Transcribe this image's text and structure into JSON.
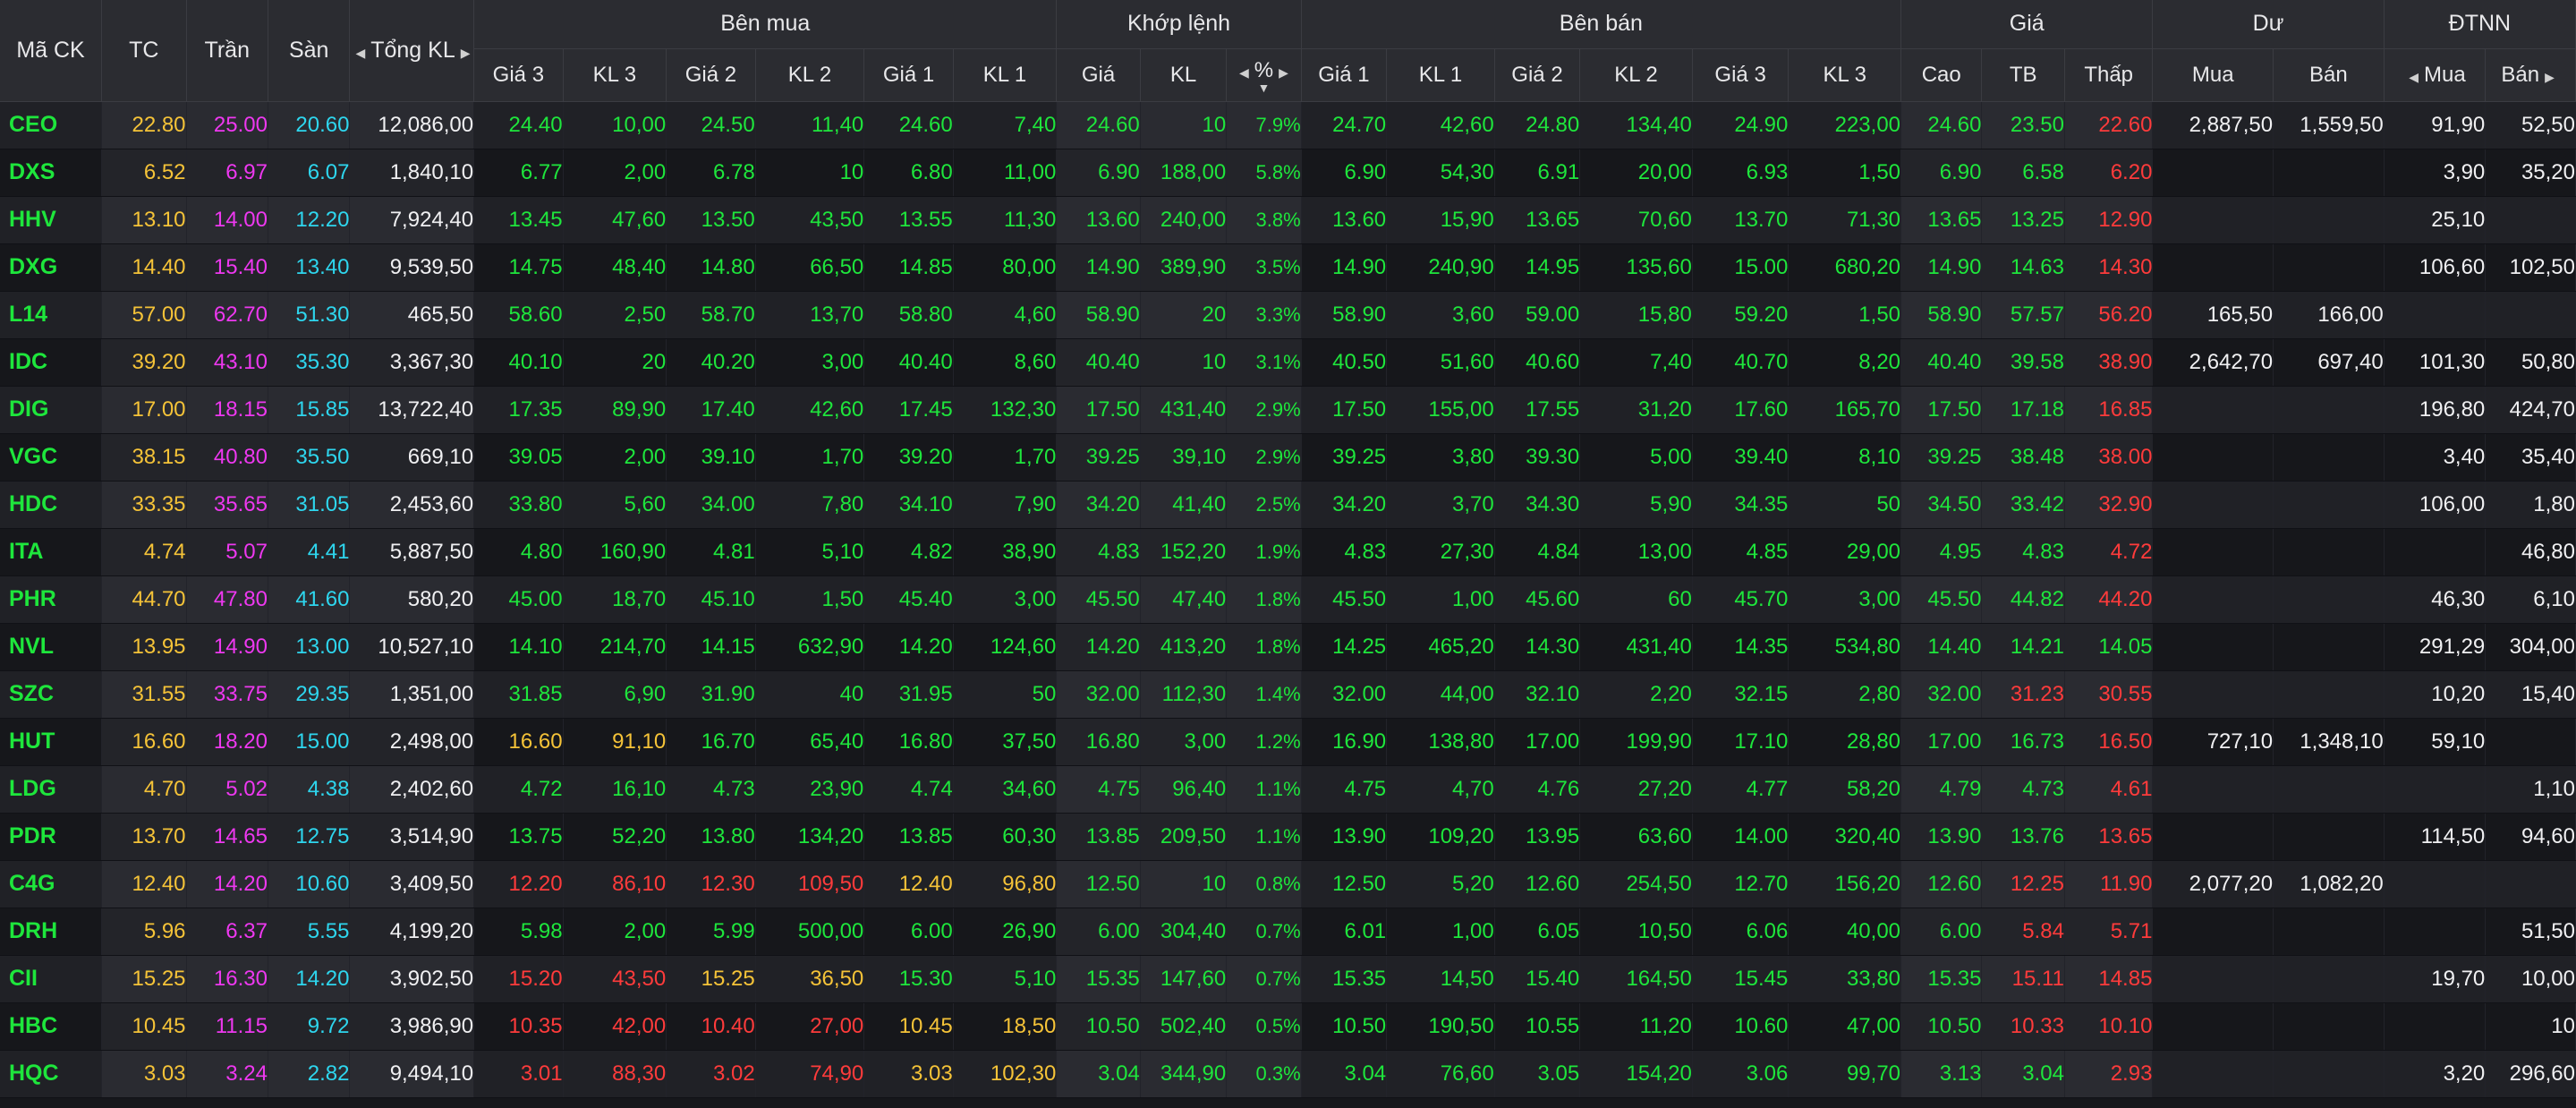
{
  "colors": {
    "up": "#1ee63c",
    "down": "#ff3b3b",
    "reference": "#f5c338",
    "ceiling": "#ee38f0",
    "floor": "#2ed6ee",
    "neutral": "#f0f0f2",
    "header_bg": "#2b2c31",
    "row_odd": "#202126",
    "row_even": "#16171b"
  },
  "icons": {
    "left": "chevron-left-icon",
    "right": "chevron-right-icon",
    "sort": "sort-desc-icon"
  },
  "header": {
    "symbol": "Mã CK",
    "ref": "TC",
    "ceiling": "Trần",
    "floor": "Sàn",
    "total_volume": "Tổng KL",
    "bid_group": "Bên mua",
    "match_group": "Khớp lệnh",
    "ask_group": "Bên bán",
    "price_group": "Giá",
    "remain_group": "Dư",
    "foreign_group": "ĐTNN",
    "bid_cols": [
      "Giá 3",
      "KL 3",
      "Giá 2",
      "KL 2",
      "Giá 1",
      "KL 1"
    ],
    "match_cols": [
      "Giá",
      "KL",
      "%"
    ],
    "ask_cols": [
      "Giá 1",
      "KL 1",
      "Giá 2",
      "KL 2",
      "Giá 3",
      "KL 3"
    ],
    "price_cols": [
      "Cao",
      "TB",
      "Thấp"
    ],
    "remain_cols": [
      "Mua",
      "Bán"
    ],
    "foreign_cols": [
      "Mua",
      "Bán"
    ]
  },
  "rows": [
    {
      "sym": "CEO",
      "tc": "22.80",
      "tran": "25.00",
      "san": "20.60",
      "tong": "12,086,00",
      "b3": "24.40",
      "bk3": "10,00",
      "b2": "24.50",
      "bk2": "11,40",
      "b1": "24.60",
      "bk1": "7,40",
      "mp": "24.60",
      "mk": "10",
      "pct": "7.9%",
      "a1": "24.70",
      "ak1": "42,60",
      "a2": "24.80",
      "ak2": "134,40",
      "a3": "24.90",
      "ak3": "223,00",
      "cao": "24.60",
      "tb": "23.50",
      "thap": "22.60",
      "dm": "2,887,50",
      "db": "1,559,50",
      "fm": "91,90",
      "fb": "52,50",
      "c": {
        "b3": "up",
        "b2": "up",
        "b1": "up",
        "mp": "up",
        "a1": "up",
        "a2": "up",
        "a3": "up",
        "cao": "up",
        "tb": "up",
        "thap": "down"
      }
    },
    {
      "sym": "DXS",
      "tc": "6.52",
      "tran": "6.97",
      "san": "6.07",
      "tong": "1,840,10",
      "b3": "6.77",
      "bk3": "2,00",
      "b2": "6.78",
      "bk2": "10",
      "b1": "6.80",
      "bk1": "11,00",
      "mp": "6.90",
      "mk": "188,00",
      "pct": "5.8%",
      "a1": "6.90",
      "ak1": "54,30",
      "a2": "6.91",
      "ak2": "20,00",
      "a3": "6.93",
      "ak3": "1,50",
      "cao": "6.90",
      "tb": "6.58",
      "thap": "6.20",
      "dm": "",
      "db": "",
      "fm": "3,90",
      "fb": "35,20",
      "c": {
        "b3": "up",
        "b2": "up",
        "b1": "up",
        "mp": "up",
        "a1": "up",
        "a2": "up",
        "a3": "up",
        "cao": "up",
        "tb": "up",
        "thap": "down"
      }
    },
    {
      "sym": "HHV",
      "tc": "13.10",
      "tran": "14.00",
      "san": "12.20",
      "tong": "7,924,40",
      "b3": "13.45",
      "bk3": "47,60",
      "b2": "13.50",
      "bk2": "43,50",
      "b1": "13.55",
      "bk1": "11,30",
      "mp": "13.60",
      "mk": "240,00",
      "pct": "3.8%",
      "a1": "13.60",
      "ak1": "15,90",
      "a2": "13.65",
      "ak2": "70,60",
      "a3": "13.70",
      "ak3": "71,30",
      "cao": "13.65",
      "tb": "13.25",
      "thap": "12.90",
      "dm": "",
      "db": "",
      "fm": "25,10",
      "fb": "",
      "c": {
        "b3": "up",
        "b2": "up",
        "b1": "up",
        "mp": "up",
        "a1": "up",
        "a2": "up",
        "a3": "up",
        "cao": "up",
        "tb": "up",
        "thap": "down"
      }
    },
    {
      "sym": "DXG",
      "tc": "14.40",
      "tran": "15.40",
      "san": "13.40",
      "tong": "9,539,50",
      "b3": "14.75",
      "bk3": "48,40",
      "b2": "14.80",
      "bk2": "66,50",
      "b1": "14.85",
      "bk1": "80,00",
      "mp": "14.90",
      "mk": "389,90",
      "pct": "3.5%",
      "a1": "14.90",
      "ak1": "240,90",
      "a2": "14.95",
      "ak2": "135,60",
      "a3": "15.00",
      "ak3": "680,20",
      "cao": "14.90",
      "tb": "14.63",
      "thap": "14.30",
      "dm": "",
      "db": "",
      "fm": "106,60",
      "fb": "102,50",
      "c": {
        "b3": "up",
        "b2": "up",
        "b1": "up",
        "mp": "up",
        "a1": "up",
        "a2": "up",
        "a3": "up",
        "cao": "up",
        "tb": "up",
        "thap": "down"
      }
    },
    {
      "sym": "L14",
      "tc": "57.00",
      "tran": "62.70",
      "san": "51.30",
      "tong": "465,50",
      "b3": "58.60",
      "bk3": "2,50",
      "b2": "58.70",
      "bk2": "13,70",
      "b1": "58.80",
      "bk1": "4,60",
      "mp": "58.90",
      "mk": "20",
      "pct": "3.3%",
      "a1": "58.90",
      "ak1": "3,60",
      "a2": "59.00",
      "ak2": "15,80",
      "a3": "59.20",
      "ak3": "1,50",
      "cao": "58.90",
      "tb": "57.57",
      "thap": "56.20",
      "dm": "165,50",
      "db": "166,00",
      "fm": "",
      "fb": "",
      "c": {
        "b3": "up",
        "b2": "up",
        "b1": "up",
        "mp": "up",
        "a1": "up",
        "a2": "up",
        "a3": "up",
        "cao": "up",
        "tb": "up",
        "thap": "down"
      }
    },
    {
      "sym": "IDC",
      "tc": "39.20",
      "tran": "43.10",
      "san": "35.30",
      "tong": "3,367,30",
      "b3": "40.10",
      "bk3": "20",
      "b2": "40.20",
      "bk2": "3,00",
      "b1": "40.40",
      "bk1": "8,60",
      "mp": "40.40",
      "mk": "10",
      "pct": "3.1%",
      "a1": "40.50",
      "ak1": "51,60",
      "a2": "40.60",
      "ak2": "7,40",
      "a3": "40.70",
      "ak3": "8,20",
      "cao": "40.40",
      "tb": "39.58",
      "thap": "38.90",
      "dm": "2,642,70",
      "db": "697,40",
      "fm": "101,30",
      "fb": "50,80",
      "c": {
        "b3": "up",
        "b2": "up",
        "b1": "up",
        "mp": "up",
        "a1": "up",
        "a2": "up",
        "a3": "up",
        "cao": "up",
        "tb": "up",
        "thap": "down"
      }
    },
    {
      "sym": "DIG",
      "tc": "17.00",
      "tran": "18.15",
      "san": "15.85",
      "tong": "13,722,40",
      "b3": "17.35",
      "bk3": "89,90",
      "b2": "17.40",
      "bk2": "42,60",
      "b1": "17.45",
      "bk1": "132,30",
      "mp": "17.50",
      "mk": "431,40",
      "pct": "2.9%",
      "a1": "17.50",
      "ak1": "155,00",
      "a2": "17.55",
      "ak2": "31,20",
      "a3": "17.60",
      "ak3": "165,70",
      "cao": "17.50",
      "tb": "17.18",
      "thap": "16.85",
      "dm": "",
      "db": "",
      "fm": "196,80",
      "fb": "424,70",
      "c": {
        "b3": "up",
        "b2": "up",
        "b1": "up",
        "mp": "up",
        "a1": "up",
        "a2": "up",
        "a3": "up",
        "cao": "up",
        "tb": "up",
        "thap": "down"
      }
    },
    {
      "sym": "VGC",
      "tc": "38.15",
      "tran": "40.80",
      "san": "35.50",
      "tong": "669,10",
      "b3": "39.05",
      "bk3": "2,00",
      "b2": "39.10",
      "bk2": "1,70",
      "b1": "39.20",
      "bk1": "1,70",
      "mp": "39.25",
      "mk": "39,10",
      "pct": "2.9%",
      "a1": "39.25",
      "ak1": "3,80",
      "a2": "39.30",
      "ak2": "5,00",
      "a3": "39.40",
      "ak3": "8,10",
      "cao": "39.25",
      "tb": "38.48",
      "thap": "38.00",
      "dm": "",
      "db": "",
      "fm": "3,40",
      "fb": "35,40",
      "c": {
        "b3": "up",
        "b2": "up",
        "b1": "up",
        "mp": "up",
        "a1": "up",
        "a2": "up",
        "a3": "up",
        "cao": "up",
        "tb": "up",
        "thap": "down"
      }
    },
    {
      "sym": "HDC",
      "tc": "33.35",
      "tran": "35.65",
      "san": "31.05",
      "tong": "2,453,60",
      "b3": "33.80",
      "bk3": "5,60",
      "b2": "34.00",
      "bk2": "7,80",
      "b1": "34.10",
      "bk1": "7,90",
      "mp": "34.20",
      "mk": "41,40",
      "pct": "2.5%",
      "a1": "34.20",
      "ak1": "3,70",
      "a2": "34.30",
      "ak2": "5,90",
      "a3": "34.35",
      "ak3": "50",
      "cao": "34.50",
      "tb": "33.42",
      "thap": "32.90",
      "dm": "",
      "db": "",
      "fm": "106,00",
      "fb": "1,80",
      "c": {
        "b3": "up",
        "b2": "up",
        "b1": "up",
        "mp": "up",
        "a1": "up",
        "a2": "up",
        "a3": "up",
        "cao": "up",
        "tb": "up",
        "thap": "down"
      }
    },
    {
      "sym": "ITA",
      "tc": "4.74",
      "tran": "5.07",
      "san": "4.41",
      "tong": "5,887,50",
      "b3": "4.80",
      "bk3": "160,90",
      "b2": "4.81",
      "bk2": "5,10",
      "b1": "4.82",
      "bk1": "38,90",
      "mp": "4.83",
      "mk": "152,20",
      "pct": "1.9%",
      "a1": "4.83",
      "ak1": "27,30",
      "a2": "4.84",
      "ak2": "13,00",
      "a3": "4.85",
      "ak3": "29,00",
      "cao": "4.95",
      "tb": "4.83",
      "thap": "4.72",
      "dm": "",
      "db": "",
      "fm": "",
      "fb": "46,80",
      "c": {
        "b3": "up",
        "b2": "up",
        "b1": "up",
        "mp": "up",
        "a1": "up",
        "a2": "up",
        "a3": "up",
        "cao": "up",
        "tb": "up",
        "thap": "down"
      }
    },
    {
      "sym": "PHR",
      "tc": "44.70",
      "tran": "47.80",
      "san": "41.60",
      "tong": "580,20",
      "b3": "45.00",
      "bk3": "18,70",
      "b2": "45.10",
      "bk2": "1,50",
      "b1": "45.40",
      "bk1": "3,00",
      "mp": "45.50",
      "mk": "47,40",
      "pct": "1.8%",
      "a1": "45.50",
      "ak1": "1,00",
      "a2": "45.60",
      "ak2": "60",
      "a3": "45.70",
      "ak3": "3,00",
      "cao": "45.50",
      "tb": "44.82",
      "thap": "44.20",
      "dm": "",
      "db": "",
      "fm": "46,30",
      "fb": "6,10",
      "c": {
        "b3": "up",
        "b2": "up",
        "b1": "up",
        "mp": "up",
        "a1": "up",
        "a2": "up",
        "a3": "up",
        "cao": "up",
        "tb": "up",
        "thap": "down"
      }
    },
    {
      "sym": "NVL",
      "tc": "13.95",
      "tran": "14.90",
      "san": "13.00",
      "tong": "10,527,10",
      "b3": "14.10",
      "bk3": "214,70",
      "b2": "14.15",
      "bk2": "632,90",
      "b1": "14.20",
      "bk1": "124,60",
      "mp": "14.20",
      "mk": "413,20",
      "pct": "1.8%",
      "a1": "14.25",
      "ak1": "465,20",
      "a2": "14.30",
      "ak2": "431,40",
      "a3": "14.35",
      "ak3": "534,80",
      "cao": "14.40",
      "tb": "14.21",
      "thap": "14.05",
      "dm": "",
      "db": "",
      "fm": "291,29",
      "fb": "304,00",
      "c": {
        "b3": "up",
        "b2": "up",
        "b1": "up",
        "mp": "up",
        "a1": "up",
        "a2": "up",
        "a3": "up",
        "cao": "up",
        "tb": "up",
        "thap": "up"
      }
    },
    {
      "sym": "SZC",
      "tc": "31.55",
      "tran": "33.75",
      "san": "29.35",
      "tong": "1,351,00",
      "b3": "31.85",
      "bk3": "6,90",
      "b2": "31.90",
      "bk2": "40",
      "b1": "31.95",
      "bk1": "50",
      "mp": "32.00",
      "mk": "112,30",
      "pct": "1.4%",
      "a1": "32.00",
      "ak1": "44,00",
      "a2": "32.10",
      "ak2": "2,20",
      "a3": "32.15",
      "ak3": "2,80",
      "cao": "32.00",
      "tb": "31.23",
      "thap": "30.55",
      "dm": "",
      "db": "",
      "fm": "10,20",
      "fb": "15,40",
      "c": {
        "b3": "up",
        "b2": "up",
        "b1": "up",
        "mp": "up",
        "a1": "up",
        "a2": "up",
        "a3": "up",
        "cao": "up",
        "tb": "down",
        "thap": "down"
      }
    },
    {
      "sym": "HUT",
      "tc": "16.60",
      "tran": "18.20",
      "san": "15.00",
      "tong": "2,498,00",
      "b3": "16.60",
      "bk3": "91,10",
      "b2": "16.70",
      "bk2": "65,40",
      "b1": "16.80",
      "bk1": "37,50",
      "mp": "16.80",
      "mk": "3,00",
      "pct": "1.2%",
      "a1": "16.90",
      "ak1": "138,80",
      "a2": "17.00",
      "ak2": "199,90",
      "a3": "17.10",
      "ak3": "28,80",
      "cao": "17.00",
      "tb": "16.73",
      "thap": "16.50",
      "dm": "727,10",
      "db": "1,348,10",
      "fm": "59,10",
      "fb": "",
      "c": {
        "b3": "ref",
        "b2": "up",
        "b1": "up",
        "mp": "up",
        "a1": "up",
        "a2": "up",
        "a3": "up",
        "cao": "up",
        "tb": "up",
        "thap": "down"
      }
    },
    {
      "sym": "LDG",
      "tc": "4.70",
      "tran": "5.02",
      "san": "4.38",
      "tong": "2,402,60",
      "b3": "4.72",
      "bk3": "16,10",
      "b2": "4.73",
      "bk2": "23,90",
      "b1": "4.74",
      "bk1": "34,60",
      "mp": "4.75",
      "mk": "96,40",
      "pct": "1.1%",
      "a1": "4.75",
      "ak1": "4,70",
      "a2": "4.76",
      "ak2": "27,20",
      "a3": "4.77",
      "ak3": "58,20",
      "cao": "4.79",
      "tb": "4.73",
      "thap": "4.61",
      "dm": "",
      "db": "",
      "fm": "",
      "fb": "1,10",
      "c": {
        "b3": "up",
        "b2": "up",
        "b1": "up",
        "mp": "up",
        "a1": "up",
        "a2": "up",
        "a3": "up",
        "cao": "up",
        "tb": "up",
        "thap": "down"
      }
    },
    {
      "sym": "PDR",
      "tc": "13.70",
      "tran": "14.65",
      "san": "12.75",
      "tong": "3,514,90",
      "b3": "13.75",
      "bk3": "52,20",
      "b2": "13.80",
      "bk2": "134,20",
      "b1": "13.85",
      "bk1": "60,30",
      "mp": "13.85",
      "mk": "209,50",
      "pct": "1.1%",
      "a1": "13.90",
      "ak1": "109,20",
      "a2": "13.95",
      "ak2": "63,60",
      "a3": "14.00",
      "ak3": "320,40",
      "cao": "13.90",
      "tb": "13.76",
      "thap": "13.65",
      "dm": "",
      "db": "",
      "fm": "114,50",
      "fb": "94,60",
      "c": {
        "b3": "up",
        "b2": "up",
        "b1": "up",
        "mp": "up",
        "a1": "up",
        "a2": "up",
        "a3": "up",
        "cao": "up",
        "tb": "up",
        "thap": "down"
      }
    },
    {
      "sym": "C4G",
      "tc": "12.40",
      "tran": "14.20",
      "san": "10.60",
      "tong": "3,409,50",
      "b3": "12.20",
      "bk3": "86,10",
      "b2": "12.30",
      "bk2": "109,50",
      "b1": "12.40",
      "bk1": "96,80",
      "mp": "12.50",
      "mk": "10",
      "pct": "0.8%",
      "a1": "12.50",
      "ak1": "5,20",
      "a2": "12.60",
      "ak2": "254,50",
      "a3": "12.70",
      "ak3": "156,20",
      "cao": "12.60",
      "tb": "12.25",
      "thap": "11.90",
      "dm": "2,077,20",
      "db": "1,082,20",
      "fm": "",
      "fb": "",
      "c": {
        "b3": "down",
        "b2": "down",
        "b1": "ref",
        "mp": "up",
        "a1": "up",
        "a2": "up",
        "a3": "up",
        "cao": "up",
        "tb": "down",
        "thap": "down"
      }
    },
    {
      "sym": "DRH",
      "tc": "5.96",
      "tran": "6.37",
      "san": "5.55",
      "tong": "4,199,20",
      "b3": "5.98",
      "bk3": "2,00",
      "b2": "5.99",
      "bk2": "500,00",
      "b1": "6.00",
      "bk1": "26,90",
      "mp": "6.00",
      "mk": "304,40",
      "pct": "0.7%",
      "a1": "6.01",
      "ak1": "1,00",
      "a2": "6.05",
      "ak2": "10,50",
      "a3": "6.06",
      "ak3": "40,00",
      "cao": "6.00",
      "tb": "5.84",
      "thap": "5.71",
      "dm": "",
      "db": "",
      "fm": "",
      "fb": "51,50",
      "c": {
        "b3": "up",
        "b2": "up",
        "b1": "up",
        "mp": "up",
        "a1": "up",
        "a2": "up",
        "a3": "up",
        "cao": "up",
        "tb": "down",
        "thap": "down"
      }
    },
    {
      "sym": "CII",
      "tc": "15.25",
      "tran": "16.30",
      "san": "14.20",
      "tong": "3,902,50",
      "b3": "15.20",
      "bk3": "43,50",
      "b2": "15.25",
      "bk2": "36,50",
      "b1": "15.30",
      "bk1": "5,10",
      "mp": "15.35",
      "mk": "147,60",
      "pct": "0.7%",
      "a1": "15.35",
      "ak1": "14,50",
      "a2": "15.40",
      "ak2": "164,50",
      "a3": "15.45",
      "ak3": "33,80",
      "cao": "15.35",
      "tb": "15.11",
      "thap": "14.85",
      "dm": "",
      "db": "",
      "fm": "19,70",
      "fb": "10,00",
      "c": {
        "b3": "down",
        "b2": "ref",
        "b1": "up",
        "mp": "up",
        "a1": "up",
        "a2": "up",
        "a3": "up",
        "cao": "up",
        "tb": "down",
        "thap": "down"
      }
    },
    {
      "sym": "HBC",
      "tc": "10.45",
      "tran": "11.15",
      "san": "9.72",
      "tong": "3,986,90",
      "b3": "10.35",
      "bk3": "42,00",
      "b2": "10.40",
      "bk2": "27,00",
      "b1": "10.45",
      "bk1": "18,50",
      "mp": "10.50",
      "mk": "502,40",
      "pct": "0.5%",
      "a1": "10.50",
      "ak1": "190,50",
      "a2": "10.55",
      "ak2": "11,20",
      "a3": "10.60",
      "ak3": "47,00",
      "cao": "10.50",
      "tb": "10.33",
      "thap": "10.10",
      "dm": "",
      "db": "",
      "fm": "",
      "fb": "10",
      "c": {
        "b3": "down",
        "b2": "down",
        "b1": "ref",
        "mp": "up",
        "a1": "up",
        "a2": "up",
        "a3": "up",
        "cao": "up",
        "tb": "down",
        "thap": "down"
      }
    },
    {
      "sym": "HQC",
      "tc": "3.03",
      "tran": "3.24",
      "san": "2.82",
      "tong": "9,494,10",
      "b3": "3.01",
      "bk3": "88,30",
      "b2": "3.02",
      "bk2": "74,90",
      "b1": "3.03",
      "bk1": "102,30",
      "mp": "3.04",
      "mk": "344,90",
      "pct": "0.3%",
      "a1": "3.04",
      "ak1": "76,60",
      "a2": "3.05",
      "ak2": "154,20",
      "a3": "3.06",
      "ak3": "99,70",
      "cao": "3.13",
      "tb": "3.04",
      "thap": "2.93",
      "dm": "",
      "db": "",
      "fm": "3,20",
      "fb": "296,60",
      "c": {
        "b3": "down",
        "b2": "down",
        "b1": "ref",
        "mp": "up",
        "a1": "up",
        "a2": "up",
        "a3": "up",
        "cao": "up",
        "tb": "up",
        "thap": "down"
      }
    }
  ]
}
